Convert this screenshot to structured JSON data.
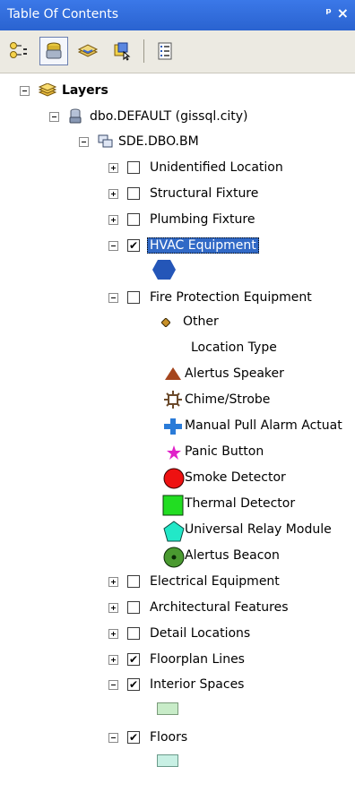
{
  "window": {
    "title": "Table Of Contents",
    "pin_glyph": "ᵖ",
    "close_glyph": "×"
  },
  "toolbar": {
    "buttons": [
      "list-by-drawing-order",
      "list-by-source",
      "list-by-visibility",
      "list-by-selection",
      "options"
    ]
  },
  "tree": {
    "root": "Layers",
    "database": "dbo.DEFAULT (gissql.city)",
    "group": "SDE.DBO.BM",
    "layers": [
      {
        "label": "Unidentified Location",
        "checked": false,
        "expanded": false
      },
      {
        "label": "Structural Fixture",
        "checked": false,
        "expanded": false
      },
      {
        "label": "Plumbing Fixture",
        "checked": false,
        "expanded": false
      },
      {
        "label": "HVAC Equipment",
        "checked": true,
        "expanded": true
      },
      {
        "label": "Fire Protection Equipment",
        "checked": false,
        "expanded": true
      },
      {
        "label": "Electrical Equipment",
        "checked": false,
        "expanded": false
      },
      {
        "label": "Architectural Features",
        "checked": false,
        "expanded": false
      },
      {
        "label": "Detail Locations",
        "checked": false,
        "expanded": false
      },
      {
        "label": "Floorplan Lines",
        "checked": true,
        "expanded": false
      },
      {
        "label": "Interior Spaces",
        "checked": true,
        "expanded": true
      },
      {
        "label": "Floors",
        "checked": true,
        "expanded": true
      }
    ],
    "check_glyph": "✔",
    "fire_legend": {
      "other": "Other",
      "field": "Location Type",
      "items": [
        {
          "label": "Alertus Speaker",
          "symbol": "triangle",
          "color": "#a5461e"
        },
        {
          "label": "Chime/Strobe",
          "symbol": "chime-strobe",
          "color": "#6b4a2b"
        },
        {
          "label": "Manual Pull Alarm Actuat",
          "symbol": "cross",
          "color": "#2a7bd8"
        },
        {
          "label": "Panic Button",
          "symbol": "star",
          "color": "#e020c8"
        },
        {
          "label": "Smoke Detector",
          "symbol": "circle",
          "color": "#ee1111"
        },
        {
          "label": "Thermal Detector",
          "symbol": "square",
          "color": "#22dd22"
        },
        {
          "label": "Universal Relay Module",
          "symbol": "pentagon",
          "color": "#22e8c8"
        },
        {
          "label": "Alertus Beacon",
          "symbol": "beacon",
          "color": "#4a9a30"
        }
      ]
    },
    "colors": {
      "hvac": "#2456b8",
      "interior": "#c8ecc8",
      "floors": "#c8f0e4",
      "selection": "#3169c6"
    }
  }
}
